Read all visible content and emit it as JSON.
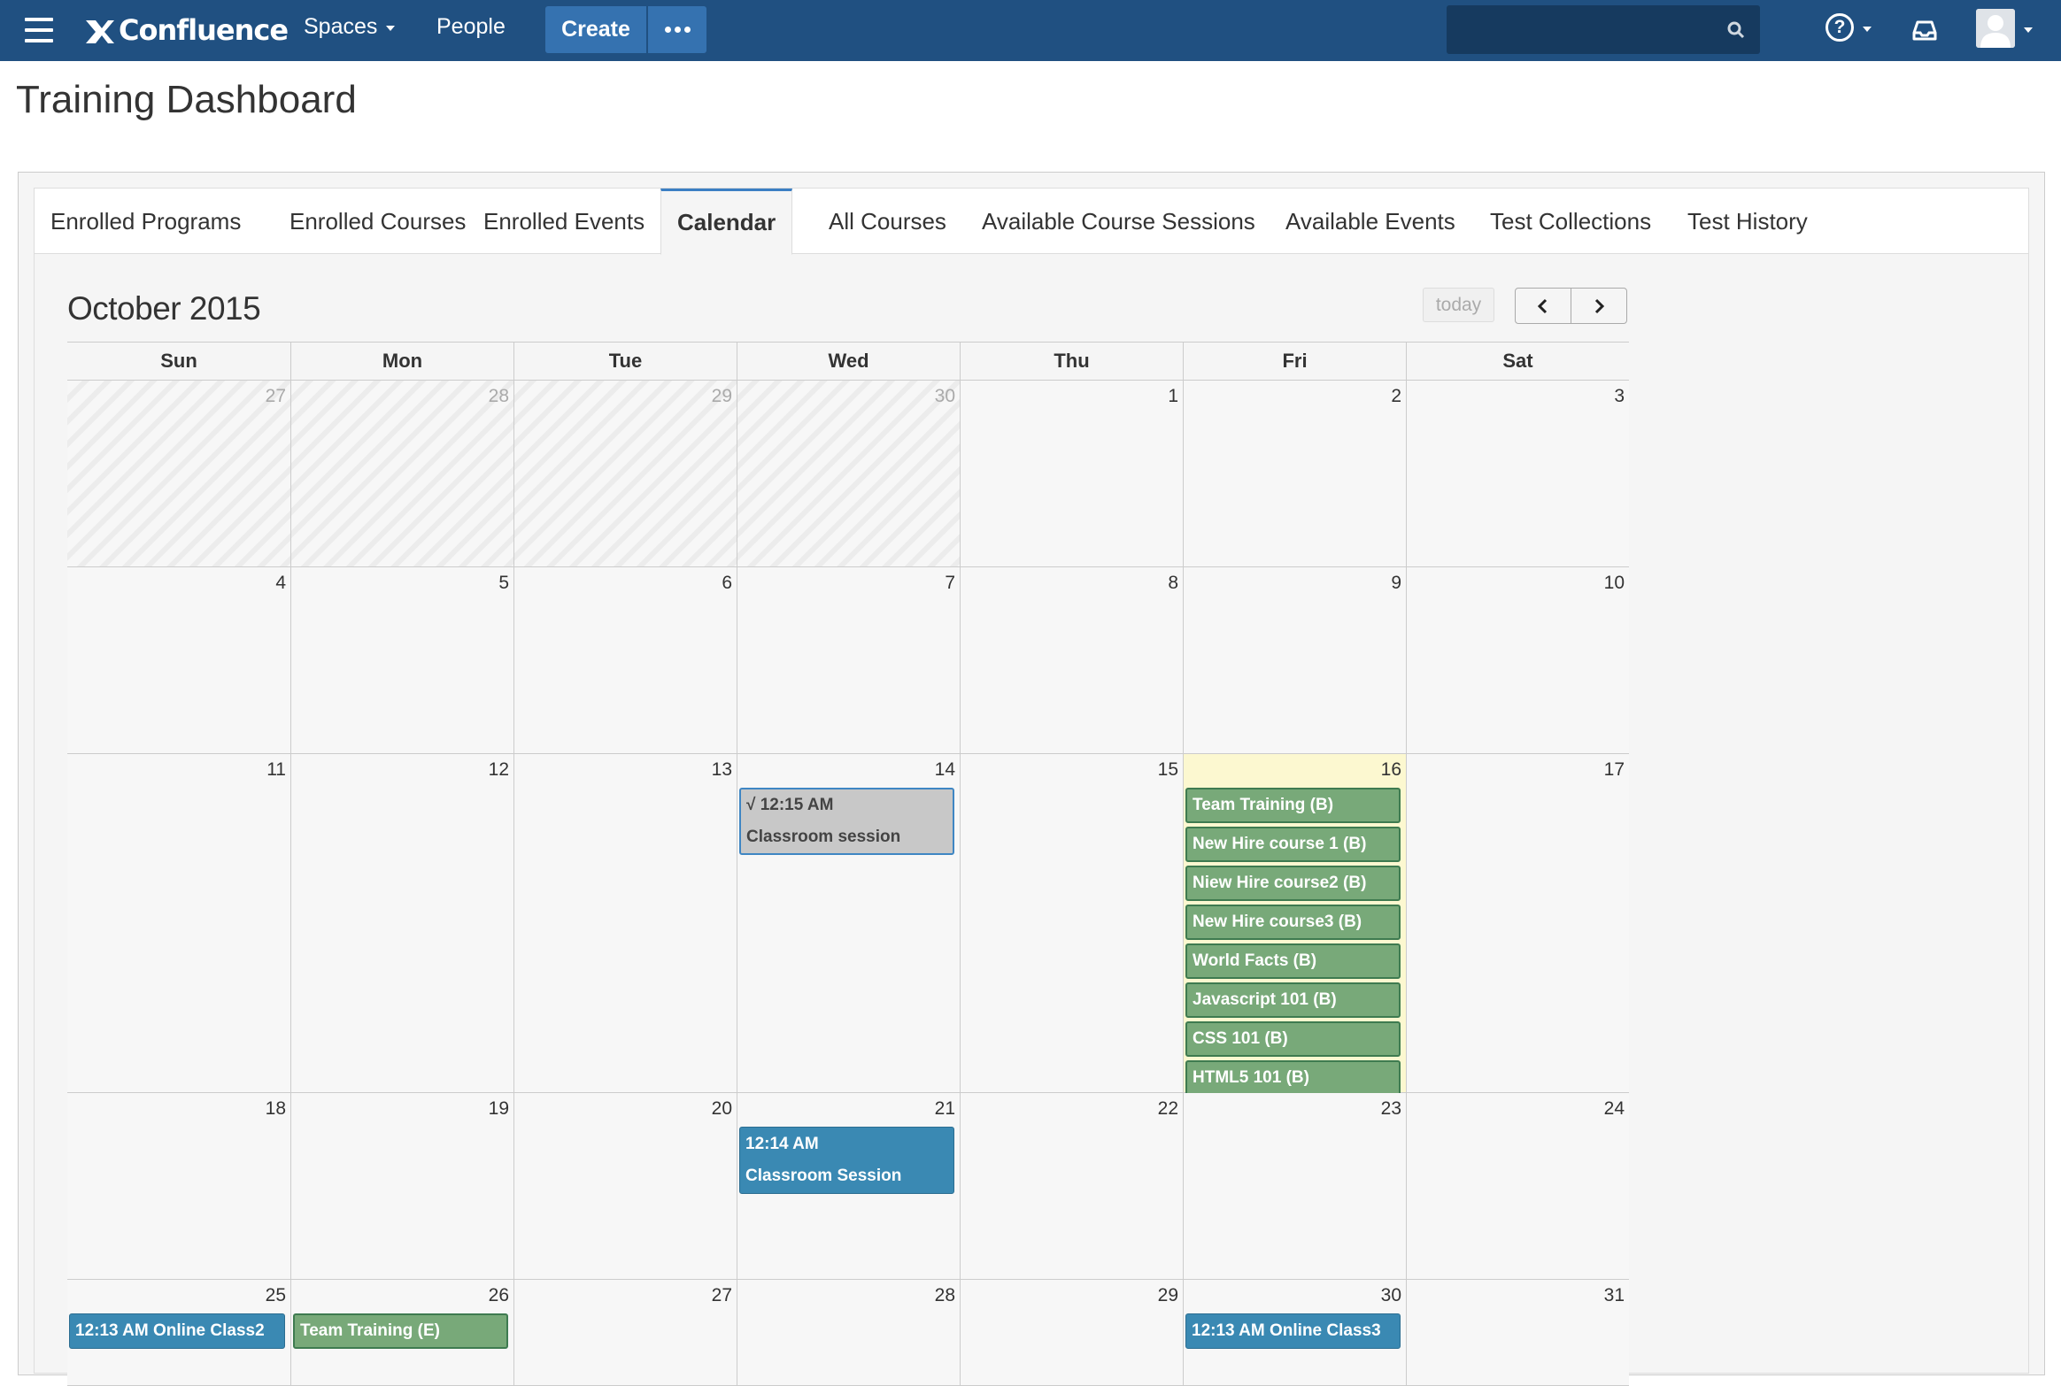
{
  "nav": {
    "logo_text": "Confluence",
    "spaces": "Spaces",
    "people": "People",
    "create": "Create",
    "search_placeholder": ""
  },
  "page": {
    "title": "Training Dashboard"
  },
  "tabs": [
    {
      "label": "Enrolled Programs"
    },
    {
      "label": "Enrolled Courses"
    },
    {
      "label": "Enrolled Events"
    },
    {
      "label": "Calendar"
    },
    {
      "label": "All Courses"
    },
    {
      "label": "Available Course Sessions"
    },
    {
      "label": "Available Events"
    },
    {
      "label": "Test Collections"
    },
    {
      "label": "Test History"
    }
  ],
  "active_tab": "Calendar",
  "calendar": {
    "title": "October 2015",
    "today_label": "today",
    "days_of_week": [
      "Sun",
      "Mon",
      "Tue",
      "Wed",
      "Thu",
      "Fri",
      "Sat"
    ],
    "weeks": [
      {
        "days": [
          {
            "num": "27",
            "other": true
          },
          {
            "num": "28",
            "other": true
          },
          {
            "num": "29",
            "other": true
          },
          {
            "num": "30",
            "other": true
          },
          {
            "num": "1"
          },
          {
            "num": "2"
          },
          {
            "num": "3"
          }
        ]
      },
      {
        "days": [
          {
            "num": "4"
          },
          {
            "num": "5"
          },
          {
            "num": "6"
          },
          {
            "num": "7"
          },
          {
            "num": "8"
          },
          {
            "num": "9"
          },
          {
            "num": "10"
          }
        ]
      },
      {
        "days": [
          {
            "num": "11"
          },
          {
            "num": "12"
          },
          {
            "num": "13"
          },
          {
            "num": "14",
            "events": [
              {
                "style": "gray",
                "line1": "√ 12:15 AM",
                "line2": "Classroom session"
              }
            ]
          },
          {
            "num": "15"
          },
          {
            "num": "16",
            "today": true,
            "events": [
              {
                "style": "green",
                "text": "Team Training (B)"
              },
              {
                "style": "green",
                "text": "New Hire course 1 (B)"
              },
              {
                "style": "green",
                "text": "Niew Hire course2 (B)"
              },
              {
                "style": "green",
                "text": "New Hire course3 (B)"
              },
              {
                "style": "green",
                "text": "World Facts (B)"
              },
              {
                "style": "green",
                "text": "Javascript 101 (B)"
              },
              {
                "style": "green",
                "text": "CSS 101 (B)"
              },
              {
                "style": "green",
                "text": "HTML5 101 (B)"
              }
            ]
          },
          {
            "num": "17"
          }
        ]
      },
      {
        "days": [
          {
            "num": "18"
          },
          {
            "num": "19"
          },
          {
            "num": "20"
          },
          {
            "num": "21",
            "events": [
              {
                "style": "blue",
                "line1": "12:14 AM",
                "line2": "Classroom Session"
              }
            ]
          },
          {
            "num": "22"
          },
          {
            "num": "23"
          },
          {
            "num": "24"
          }
        ]
      },
      {
        "days": [
          {
            "num": "25",
            "events": [
              {
                "style": "blue",
                "text": "12:13 AM Online Class2"
              }
            ]
          },
          {
            "num": "26",
            "events": [
              {
                "style": "green",
                "text": "Team Training (E)"
              }
            ]
          },
          {
            "num": "27"
          },
          {
            "num": "28"
          },
          {
            "num": "29"
          },
          {
            "num": "30",
            "events": [
              {
                "style": "blue",
                "text": "12:13 AM Online Class3"
              }
            ]
          },
          {
            "num": "31"
          }
        ]
      }
    ]
  },
  "colors": {
    "header": "#205081",
    "create_button": "#3572b0",
    "event_green": "#78a979",
    "event_blue": "#3a89b3",
    "event_gray": "#c8c8c8",
    "today_highlight": "#fcf8d0"
  }
}
